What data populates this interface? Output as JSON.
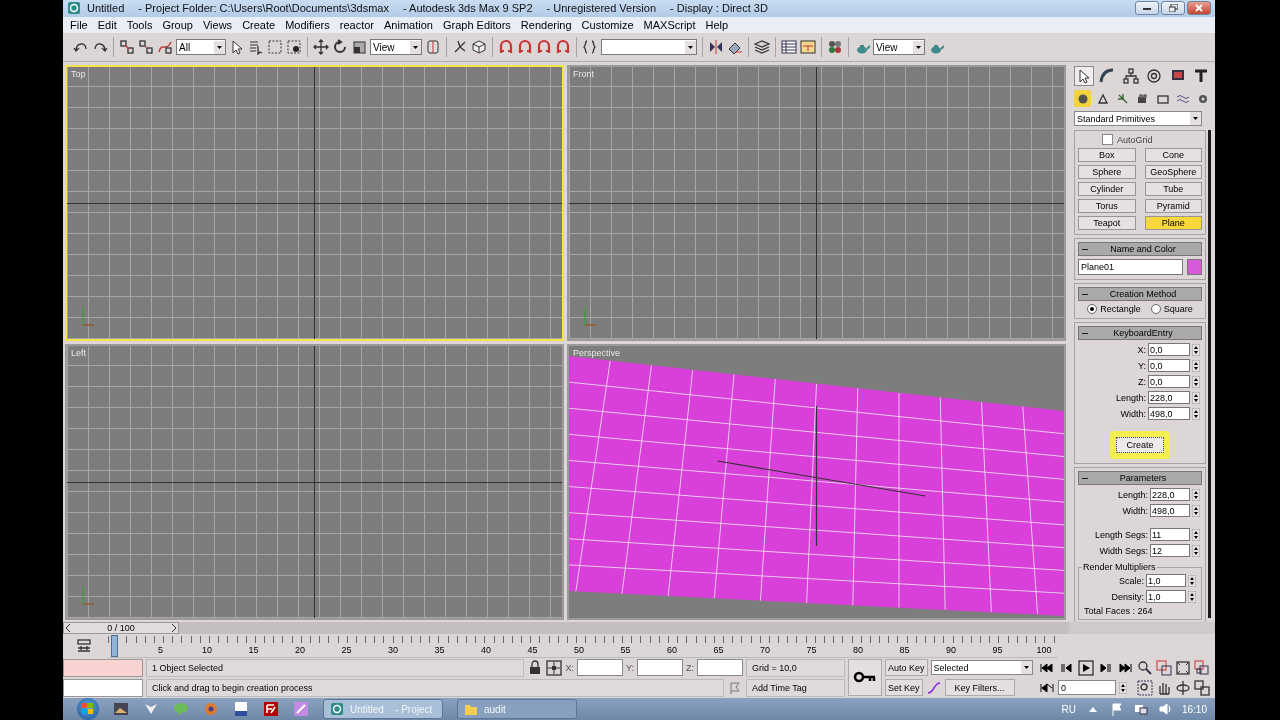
{
  "window": {
    "title_parts": [
      "Untitled",
      "- Project Folder: C:\\Users\\Root\\Documents\\3dsmax",
      "- Autodesk 3ds Max 9 SP2",
      "- Unregistered Version",
      "- Display : Direct 3D"
    ]
  },
  "menu": [
    "File",
    "Edit",
    "Tools",
    "Group",
    "Views",
    "Create",
    "Modifiers",
    "reactor",
    "Animation",
    "Graph Editors",
    "Rendering",
    "Customize",
    "MAXScript",
    "Help"
  ],
  "toolbar": {
    "selection_filter": "All",
    "coordinate_system": "View",
    "render_view": "View"
  },
  "viewports": [
    {
      "label": "Top",
      "kind": "ortho",
      "selected": true
    },
    {
      "label": "Front",
      "kind": "ortho",
      "selected": false
    },
    {
      "label": "Left",
      "kind": "ortho",
      "selected": false
    },
    {
      "label": "Perspective",
      "kind": "perspective",
      "selected": false
    }
  ],
  "command_panel": {
    "tabs": [
      {
        "selected": true
      },
      {
        "selected": false
      },
      {
        "selected": false
      },
      {
        "selected": false
      },
      {
        "selected": false
      },
      {
        "selected": false
      }
    ],
    "categories": [
      {
        "selected": true
      },
      {
        "selected": false
      },
      {
        "selected": false
      },
      {
        "selected": false
      },
      {
        "selected": false
      },
      {
        "selected": false
      },
      {
        "selected": false
      }
    ],
    "object_class": "Standard Primitives",
    "autogrid": {
      "label": "AutoGrid",
      "checked": false
    },
    "object_types": [
      {
        "label": "Box",
        "selected": false
      },
      {
        "label": "Cone",
        "selected": false
      },
      {
        "label": "Sphere",
        "selected": false
      },
      {
        "label": "GeoSphere",
        "selected": false
      },
      {
        "label": "Cylinder",
        "selected": false
      },
      {
        "label": "Tube",
        "selected": false
      },
      {
        "label": "Torus",
        "selected": false
      },
      {
        "label": "Pyramid",
        "selected": false
      },
      {
        "label": "Teapot",
        "selected": false
      },
      {
        "label": "Plane",
        "selected": true
      }
    ],
    "name_and_color": {
      "title": "Name and Color",
      "name": "Plane01",
      "color": "#d45ad8"
    },
    "creation_method": {
      "title": "Creation Method",
      "options": [
        {
          "label": "Rectangle",
          "selected": true
        },
        {
          "label": "Square",
          "selected": false
        }
      ]
    },
    "keyboard_entry": {
      "title": "KeyboardEntry",
      "fields": [
        {
          "label": "X:",
          "value": "0,0"
        },
        {
          "label": "Y:",
          "value": "0,0"
        },
        {
          "label": "Z:",
          "value": "0,0"
        },
        {
          "label": "Length:",
          "value": "228,0"
        },
        {
          "label": "Width:",
          "value": "498,0"
        }
      ],
      "button": "Create"
    },
    "parameters": {
      "title": "Parameters",
      "fields": [
        {
          "label": "Length:",
          "value": "228,0"
        },
        {
          "label": "Width:",
          "value": "498,0"
        },
        {
          "label": "Length Segs:",
          "value": "11"
        },
        {
          "label": "Width Segs:",
          "value": "12"
        }
      ],
      "group_title": "Render Multipliers",
      "group_fields": [
        {
          "label": "Scale:",
          "value": "1,0"
        },
        {
          "label": "Density:",
          "value": "1,0"
        }
      ],
      "total_faces": "Total Faces : 264"
    }
  },
  "time_slider": {
    "label": "0 / 100"
  },
  "track_bar": {
    "ticks": [
      "5",
      "10",
      "15",
      "20",
      "25",
      "30",
      "35",
      "40",
      "45",
      "50",
      "55",
      "60",
      "65",
      "70",
      "75",
      "80",
      "85",
      "90",
      "95",
      "100"
    ]
  },
  "status": {
    "selection": "1 Object Selected",
    "prompt": "Click and drag to begin creation process",
    "axes": [
      "X:",
      "Y:",
      "Z:"
    ],
    "grid": "Grid = 10,0",
    "time_tag": "Add Time Tag"
  },
  "animation": {
    "auto_key": "Auto Key",
    "set_key": "Set Key",
    "key_mode": "Selected",
    "key_filters": "Key Filters...",
    "frame": "0"
  },
  "taskbar": {
    "tasks": [
      {
        "label": "Untitled    - Project",
        "selected": true
      },
      {
        "label": "audit",
        "selected": false
      }
    ],
    "language": "RU",
    "clock": "16:10"
  }
}
